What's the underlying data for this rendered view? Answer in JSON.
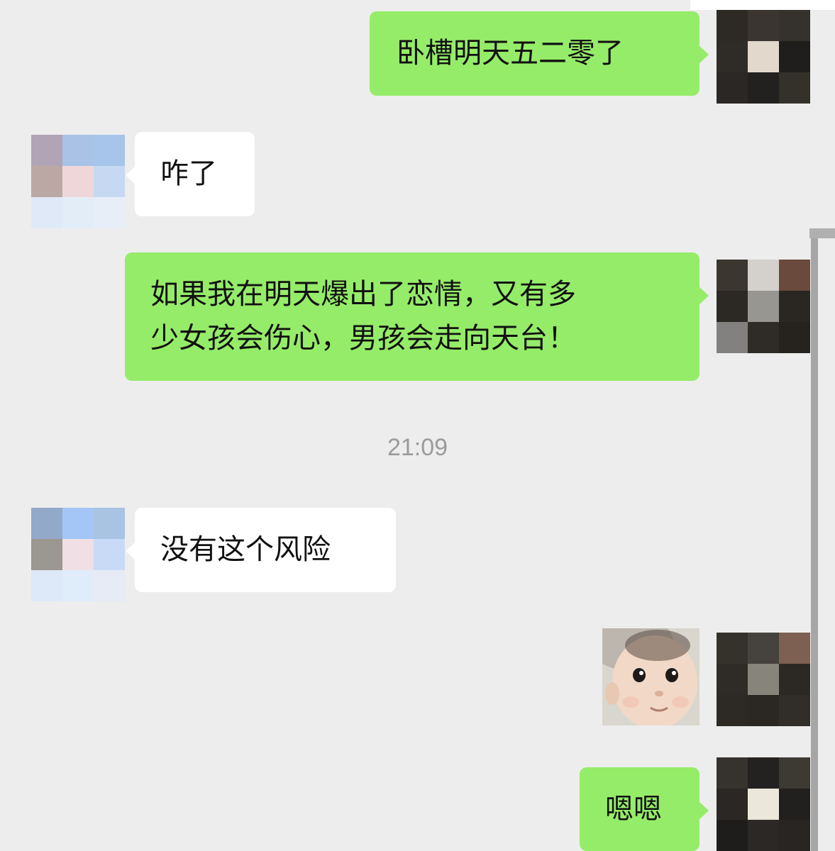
{
  "chat": {
    "messages": [
      {
        "side": "me",
        "text": "卧槽明天五二零了"
      },
      {
        "side": "them",
        "text": "咋了"
      },
      {
        "side": "me",
        "line1": "如果我在明天爆出了恋情，又有多",
        "line2": "少女孩会伤心，男孩会走向天台！"
      },
      {
        "side": "them",
        "text": "没有这个风险"
      },
      {
        "side": "me",
        "type": "sticker",
        "description_icon": "baby-face-sticker"
      },
      {
        "side": "me",
        "text": "嗯嗯"
      }
    ],
    "timestamp": "21:09"
  },
  "colors": {
    "background": "#ededed",
    "my_bubble": "#95ec69",
    "their_bubble": "#ffffff",
    "timestamp_text": "#9b9b9b"
  }
}
